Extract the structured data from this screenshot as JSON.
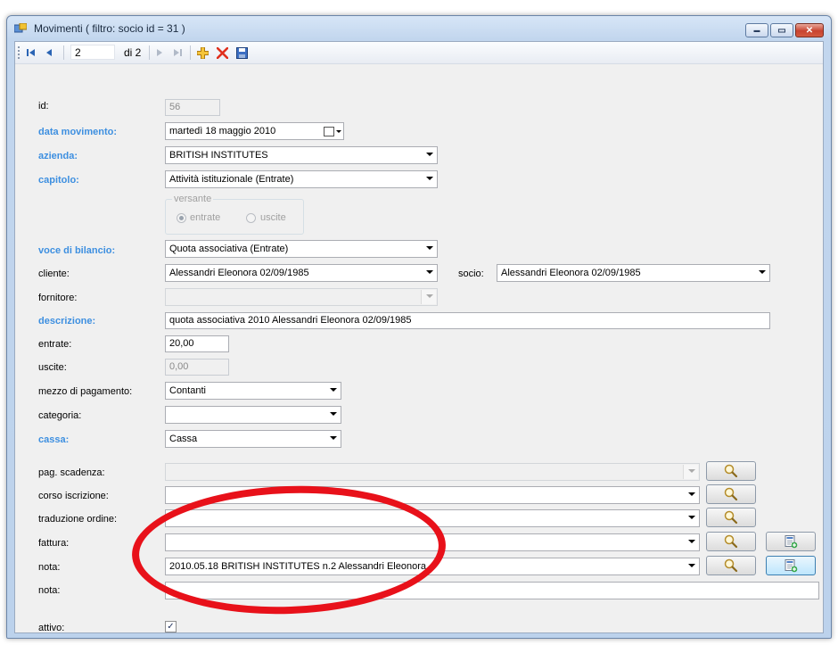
{
  "window": {
    "title": "Movimenti ( filtro: socio id = 31 )",
    "controls": {
      "minimize": "▬",
      "maximize": "▭",
      "close": "✕"
    }
  },
  "toolbar": {
    "position": "2",
    "of_count": "di 2"
  },
  "form": {
    "id": {
      "label": "id:",
      "value": "56"
    },
    "data_movimento": {
      "label": "data movimento:",
      "value": "martedì   18   maggio   2010"
    },
    "azienda": {
      "label": "azienda:",
      "value": "BRITISH INSTITUTES"
    },
    "capitolo": {
      "label": "capitolo:",
      "value": "Attività istituzionale (Entrate)"
    },
    "versante": {
      "title": "versante",
      "entrate": "entrate",
      "uscite": "uscite"
    },
    "voce_di_bilancio": {
      "label": "voce di bilancio:",
      "value": "Quota associativa (Entrate)"
    },
    "cliente": {
      "label": "cliente:",
      "value": "Alessandri Eleonora 02/09/1985"
    },
    "socio": {
      "label": "socio:",
      "value": "Alessandri Eleonora 02/09/1985"
    },
    "fornitore": {
      "label": "fornitore:",
      "value": ""
    },
    "descrizione": {
      "label": "descrizione:",
      "value": "quota associativa 2010 Alessandri Eleonora 02/09/1985"
    },
    "entrate": {
      "label": "entrate:",
      "value": "20,00"
    },
    "uscite": {
      "label": "uscite:",
      "value": "0,00"
    },
    "mezzo_di_pagamento": {
      "label": "mezzo di pagamento:",
      "value": "Contanti"
    },
    "categoria": {
      "label": "categoria:",
      "value": ""
    },
    "cassa": {
      "label": "cassa:",
      "value": "Cassa"
    },
    "pag_scadenza": {
      "label": "pag. scadenza:",
      "value": ""
    },
    "corso_iscrizione": {
      "label": "corso iscrizione:",
      "value": ""
    },
    "traduzione_ordine": {
      "label": "traduzione ordine:",
      "value": ""
    },
    "fattura": {
      "label": "fattura:",
      "value": ""
    },
    "nota_combo": {
      "label": "nota:",
      "value": "2010.05.18 BRITISH INSTITUTES n.2 Alessandri Eleonora"
    },
    "nota_text": {
      "label": "nota:",
      "value": ""
    },
    "attivo": {
      "label": "attivo:",
      "checked": true,
      "mark": "✓"
    }
  },
  "colors": {
    "required_label": "#3d8fe0",
    "highlight_ellipse": "#e8111a"
  }
}
